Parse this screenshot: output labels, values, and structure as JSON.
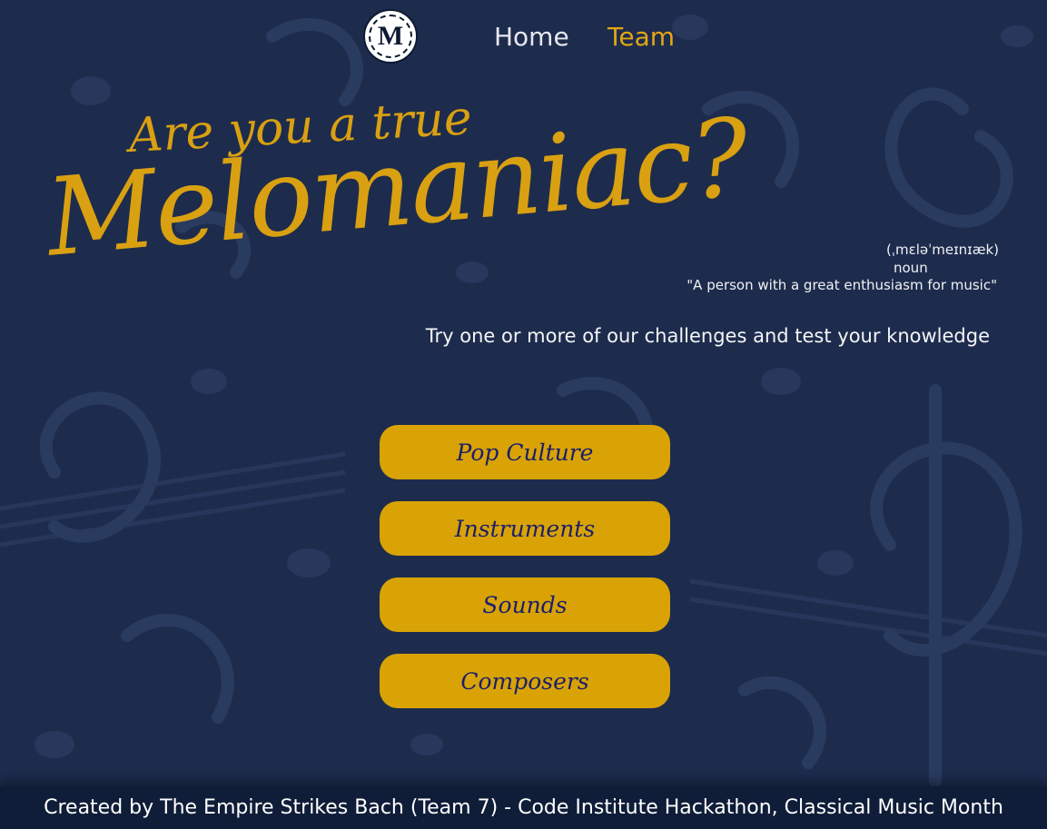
{
  "nav": {
    "logo_letter": "M",
    "home_label": "Home",
    "team_label": "Team"
  },
  "hero": {
    "line1": "Are you a true",
    "line2": "Melomaniac?",
    "pronunciation": "(ˌmɛləˈmeɪnɪæk)",
    "part_of_speech": "noun",
    "definition": "\"A person with a great enthusiasm for music\"",
    "tagline": "Try one or more of our challenges and test your knowledge"
  },
  "challenges": [
    {
      "label": "Pop Culture"
    },
    {
      "label": "Instruments"
    },
    {
      "label": "Sounds"
    },
    {
      "label": "Composers"
    }
  ],
  "footer": {
    "credit": "Created by The Empire Strikes Bach (Team 7) - Code Institute Hackathon, Classical Music Month"
  },
  "colors": {
    "background": "#1d2c4d",
    "accent_gold": "#d9a306",
    "button_text": "#1b1f6b",
    "footer_bg": "#0f1d38"
  }
}
